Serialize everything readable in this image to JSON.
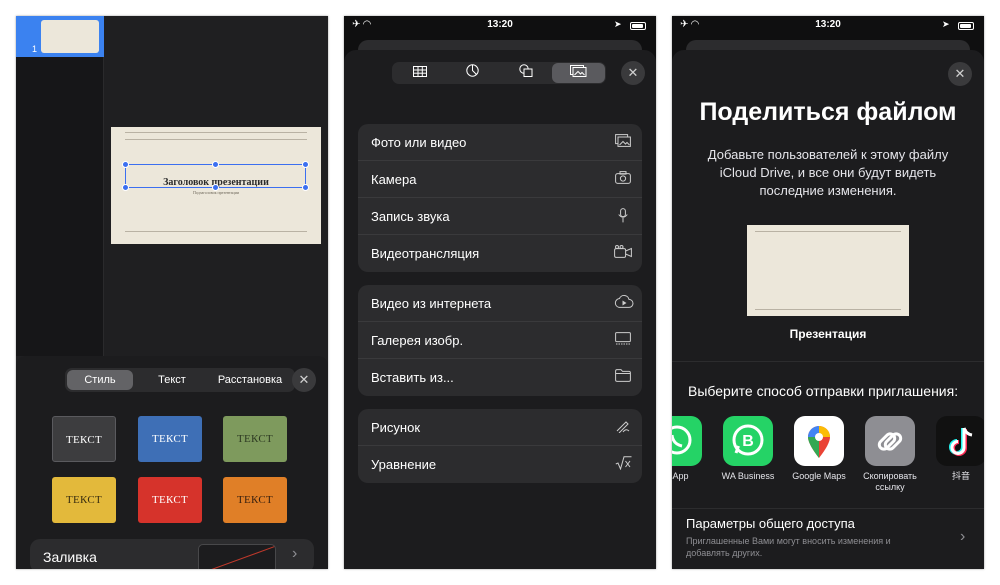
{
  "status_bar": {
    "time": "13:20"
  },
  "panel1": {
    "slide_number": "1",
    "slide_title": "Заголовок презентации",
    "slide_subtitle": "Подзаголовок презентации",
    "tabs": [
      "Стиль",
      "Текст",
      "Расстановка"
    ],
    "active_tab": "Стиль",
    "style_tiles": [
      {
        "label": "ТЕКСТ",
        "color": "#3d3d3f"
      },
      {
        "label": "ТЕКСТ",
        "color": "#3e6fb6"
      },
      {
        "label": "ТЕКСТ",
        "color": "#7e9a5d"
      },
      {
        "label": "ТЕКСТ",
        "color": "#e3b93b"
      },
      {
        "label": "ТЕКСТ",
        "color": "#d6332b"
      },
      {
        "label": "ТЕКСТ",
        "color": "#e07f27"
      }
    ],
    "fill_label": "Заливка"
  },
  "panel2": {
    "groups": [
      [
        {
          "label": "Фото или видео",
          "icon": "photo-icon"
        },
        {
          "label": "Камера",
          "icon": "camera-icon"
        },
        {
          "label": "Запись звука",
          "icon": "microphone-icon"
        },
        {
          "label": "Видеотрансляция",
          "icon": "video-camera-icon"
        }
      ],
      [
        {
          "label": "Видео из интернета",
          "icon": "cloud-play-icon"
        },
        {
          "label": "Галерея изобр.",
          "icon": "gallery-icon"
        },
        {
          "label": "Вставить из...",
          "icon": "folder-icon"
        }
      ],
      [
        {
          "label": "Рисунок",
          "icon": "pencil-icon"
        },
        {
          "label": "Уравнение",
          "icon": "square-root-icon"
        }
      ]
    ]
  },
  "panel3": {
    "title": "Поделиться файлом",
    "description": "Добавьте пользователей к этому файлу iCloud Drive, и все они будут видеть последние изменения.",
    "document_name": "Презентация",
    "invite_label": "Выберите способ отправки приглашения:",
    "apps": [
      {
        "label": "tsApp",
        "icon": "whatsapp-icon",
        "color": "#25d366"
      },
      {
        "label": "WA Business",
        "icon": "wa-business-icon",
        "color": "#25d366"
      },
      {
        "label": "Google Maps",
        "icon": "google-maps-icon",
        "color": "#ffffff"
      },
      {
        "label": "Скопировать ссылку",
        "icon": "link-icon",
        "color": "#8e8e93"
      },
      {
        "label": "抖音",
        "icon": "tiktok-icon",
        "color": "#111111"
      }
    ],
    "access_title": "Параметры общего доступа",
    "access_desc": "Приглашенные Вами могут вносить изменения и добавлять других."
  }
}
